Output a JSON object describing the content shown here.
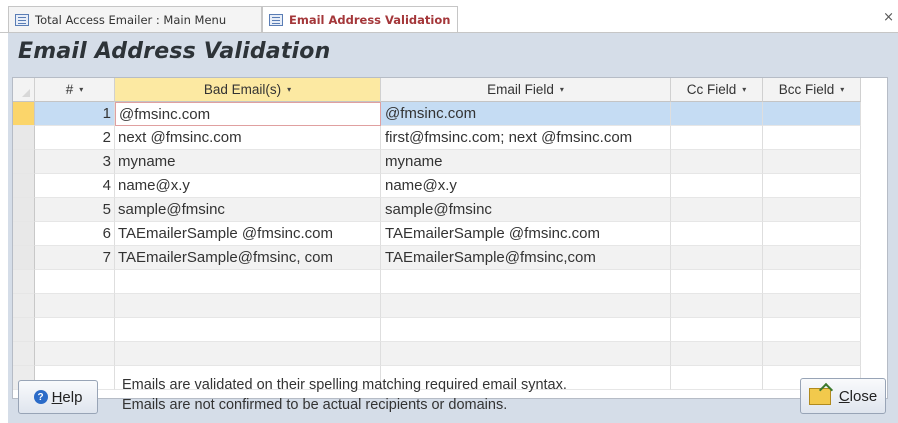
{
  "tabs": [
    {
      "label": "Total Access Emailer : Main Menu",
      "active": false
    },
    {
      "label": "Email Address Validation",
      "active": true
    }
  ],
  "tab_close_glyph": "×",
  "form": {
    "title": "Email Address Validation"
  },
  "datasheet": {
    "columns": [
      {
        "label": "#",
        "dropdown": "▾"
      },
      {
        "label": "Bad Email(s)",
        "dropdown": "▾"
      },
      {
        "label": "Email Field",
        "dropdown": "▾"
      },
      {
        "label": "Cc Field",
        "dropdown": "▾"
      },
      {
        "label": "Bcc Field",
        "dropdown": "▾"
      }
    ],
    "rows": [
      {
        "num": "1",
        "bad": "@fmsinc.com",
        "email": "@fmsinc.com",
        "cc": "",
        "bcc": ""
      },
      {
        "num": "2",
        "bad": "next @fmsinc.com",
        "email": "first@fmsinc.com; next @fmsinc.com",
        "cc": "",
        "bcc": ""
      },
      {
        "num": "3",
        "bad": "myname",
        "email": "myname",
        "cc": "",
        "bcc": ""
      },
      {
        "num": "4",
        "bad": "name@x.y",
        "email": "name@x.y",
        "cc": "",
        "bcc": ""
      },
      {
        "num": "5",
        "bad": "sample@fmsinc",
        "email": "sample@fmsinc",
        "cc": "",
        "bcc": ""
      },
      {
        "num": "6",
        "bad": "TAEmailerSample @fmsinc.com",
        "email": "TAEmailerSample @fmsinc.com",
        "cc": "",
        "bcc": ""
      },
      {
        "num": "7",
        "bad": "TAEmailerSample@fmsinc, com",
        "email": "TAEmailerSample@fmsinc,com",
        "cc": "",
        "bcc": ""
      }
    ]
  },
  "footer": {
    "help_button": {
      "mnemonic": "H",
      "rest": "elp",
      "icon": "help-icon"
    },
    "note_line1": "Emails are validated on their spelling matching required email syntax.",
    "note_line2": "Emails are not confirmed to be actual recipients or domains.",
    "close_button": {
      "mnemonic": "C",
      "rest": "lose",
      "icon": "close-icon"
    }
  },
  "colors": {
    "form_background": "#d5dde8",
    "selected_row": "#c5dcf3",
    "row_selector_current": "#fbd56a",
    "header_highlight": "#fce9a2",
    "active_tab_text": "#a4373a"
  }
}
